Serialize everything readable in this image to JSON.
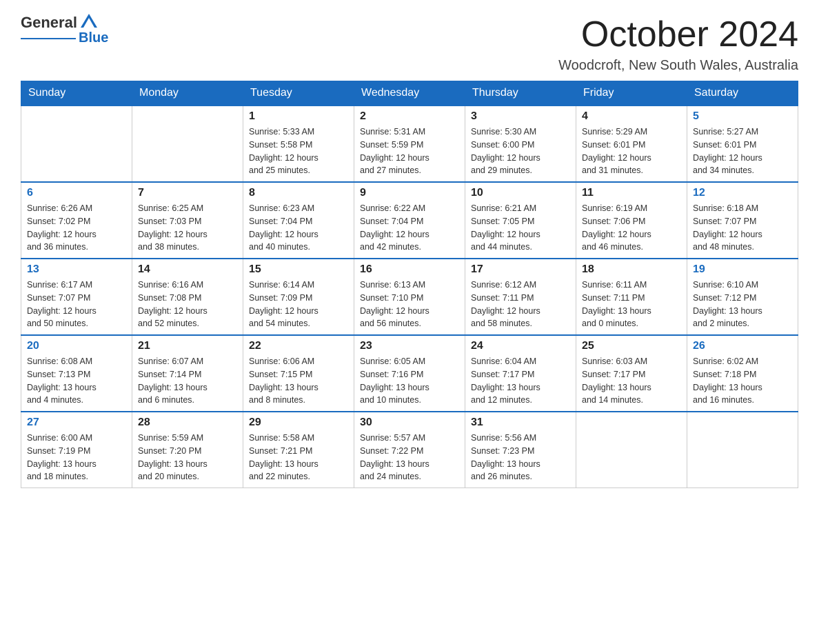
{
  "logo": {
    "general": "General",
    "blue": "Blue"
  },
  "header": {
    "month": "October 2024",
    "location": "Woodcroft, New South Wales, Australia"
  },
  "days_of_week": [
    "Sunday",
    "Monday",
    "Tuesday",
    "Wednesday",
    "Thursday",
    "Friday",
    "Saturday"
  ],
  "weeks": [
    [
      {
        "day": "",
        "info": ""
      },
      {
        "day": "",
        "info": ""
      },
      {
        "day": "1",
        "info": "Sunrise: 5:33 AM\nSunset: 5:58 PM\nDaylight: 12 hours\nand 25 minutes."
      },
      {
        "day": "2",
        "info": "Sunrise: 5:31 AM\nSunset: 5:59 PM\nDaylight: 12 hours\nand 27 minutes."
      },
      {
        "day": "3",
        "info": "Sunrise: 5:30 AM\nSunset: 6:00 PM\nDaylight: 12 hours\nand 29 minutes."
      },
      {
        "day": "4",
        "info": "Sunrise: 5:29 AM\nSunset: 6:01 PM\nDaylight: 12 hours\nand 31 minutes."
      },
      {
        "day": "5",
        "info": "Sunrise: 5:27 AM\nSunset: 6:01 PM\nDaylight: 12 hours\nand 34 minutes."
      }
    ],
    [
      {
        "day": "6",
        "info": "Sunrise: 6:26 AM\nSunset: 7:02 PM\nDaylight: 12 hours\nand 36 minutes."
      },
      {
        "day": "7",
        "info": "Sunrise: 6:25 AM\nSunset: 7:03 PM\nDaylight: 12 hours\nand 38 minutes."
      },
      {
        "day": "8",
        "info": "Sunrise: 6:23 AM\nSunset: 7:04 PM\nDaylight: 12 hours\nand 40 minutes."
      },
      {
        "day": "9",
        "info": "Sunrise: 6:22 AM\nSunset: 7:04 PM\nDaylight: 12 hours\nand 42 minutes."
      },
      {
        "day": "10",
        "info": "Sunrise: 6:21 AM\nSunset: 7:05 PM\nDaylight: 12 hours\nand 44 minutes."
      },
      {
        "day": "11",
        "info": "Sunrise: 6:19 AM\nSunset: 7:06 PM\nDaylight: 12 hours\nand 46 minutes."
      },
      {
        "day": "12",
        "info": "Sunrise: 6:18 AM\nSunset: 7:07 PM\nDaylight: 12 hours\nand 48 minutes."
      }
    ],
    [
      {
        "day": "13",
        "info": "Sunrise: 6:17 AM\nSunset: 7:07 PM\nDaylight: 12 hours\nand 50 minutes."
      },
      {
        "day": "14",
        "info": "Sunrise: 6:16 AM\nSunset: 7:08 PM\nDaylight: 12 hours\nand 52 minutes."
      },
      {
        "day": "15",
        "info": "Sunrise: 6:14 AM\nSunset: 7:09 PM\nDaylight: 12 hours\nand 54 minutes."
      },
      {
        "day": "16",
        "info": "Sunrise: 6:13 AM\nSunset: 7:10 PM\nDaylight: 12 hours\nand 56 minutes."
      },
      {
        "day": "17",
        "info": "Sunrise: 6:12 AM\nSunset: 7:11 PM\nDaylight: 12 hours\nand 58 minutes."
      },
      {
        "day": "18",
        "info": "Sunrise: 6:11 AM\nSunset: 7:11 PM\nDaylight: 13 hours\nand 0 minutes."
      },
      {
        "day": "19",
        "info": "Sunrise: 6:10 AM\nSunset: 7:12 PM\nDaylight: 13 hours\nand 2 minutes."
      }
    ],
    [
      {
        "day": "20",
        "info": "Sunrise: 6:08 AM\nSunset: 7:13 PM\nDaylight: 13 hours\nand 4 minutes."
      },
      {
        "day": "21",
        "info": "Sunrise: 6:07 AM\nSunset: 7:14 PM\nDaylight: 13 hours\nand 6 minutes."
      },
      {
        "day": "22",
        "info": "Sunrise: 6:06 AM\nSunset: 7:15 PM\nDaylight: 13 hours\nand 8 minutes."
      },
      {
        "day": "23",
        "info": "Sunrise: 6:05 AM\nSunset: 7:16 PM\nDaylight: 13 hours\nand 10 minutes."
      },
      {
        "day": "24",
        "info": "Sunrise: 6:04 AM\nSunset: 7:17 PM\nDaylight: 13 hours\nand 12 minutes."
      },
      {
        "day": "25",
        "info": "Sunrise: 6:03 AM\nSunset: 7:17 PM\nDaylight: 13 hours\nand 14 minutes."
      },
      {
        "day": "26",
        "info": "Sunrise: 6:02 AM\nSunset: 7:18 PM\nDaylight: 13 hours\nand 16 minutes."
      }
    ],
    [
      {
        "day": "27",
        "info": "Sunrise: 6:00 AM\nSunset: 7:19 PM\nDaylight: 13 hours\nand 18 minutes."
      },
      {
        "day": "28",
        "info": "Sunrise: 5:59 AM\nSunset: 7:20 PM\nDaylight: 13 hours\nand 20 minutes."
      },
      {
        "day": "29",
        "info": "Sunrise: 5:58 AM\nSunset: 7:21 PM\nDaylight: 13 hours\nand 22 minutes."
      },
      {
        "day": "30",
        "info": "Sunrise: 5:57 AM\nSunset: 7:22 PM\nDaylight: 13 hours\nand 24 minutes."
      },
      {
        "day": "31",
        "info": "Sunrise: 5:56 AM\nSunset: 7:23 PM\nDaylight: 13 hours\nand 26 minutes."
      },
      {
        "day": "",
        "info": ""
      },
      {
        "day": "",
        "info": ""
      }
    ]
  ]
}
